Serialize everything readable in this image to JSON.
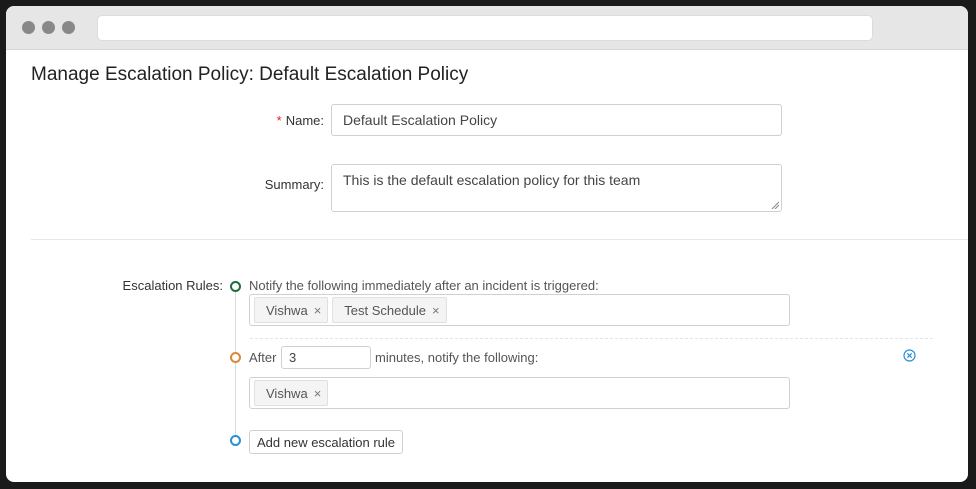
{
  "page": {
    "title": "Manage Escalation Policy: Default Escalation Policy"
  },
  "form": {
    "name_required_mark": "*",
    "name_label": "Name:",
    "name_value": "Default Escalation Policy",
    "summary_label": "Summary:",
    "summary_value": "This is the default escalation policy for this team"
  },
  "escalation": {
    "label": "Escalation Rules:",
    "rules": [
      {
        "text": "Notify the following immediately after an incident is triggered:",
        "targets": [
          "Vishwa",
          "Test Schedule"
        ]
      },
      {
        "prefix": "After",
        "minutes": "3",
        "suffix": "minutes, notify the following:",
        "targets": [
          "Vishwa"
        ]
      }
    ],
    "add_button_label": "Add new escalation rule",
    "remove_glyph": "×"
  },
  "colors": {
    "node_first": "#1f6b3a",
    "node_second": "#d9893a",
    "node_add": "#2b8fd6",
    "remove_icon": "#2b8fd6",
    "required": "#e02020"
  }
}
